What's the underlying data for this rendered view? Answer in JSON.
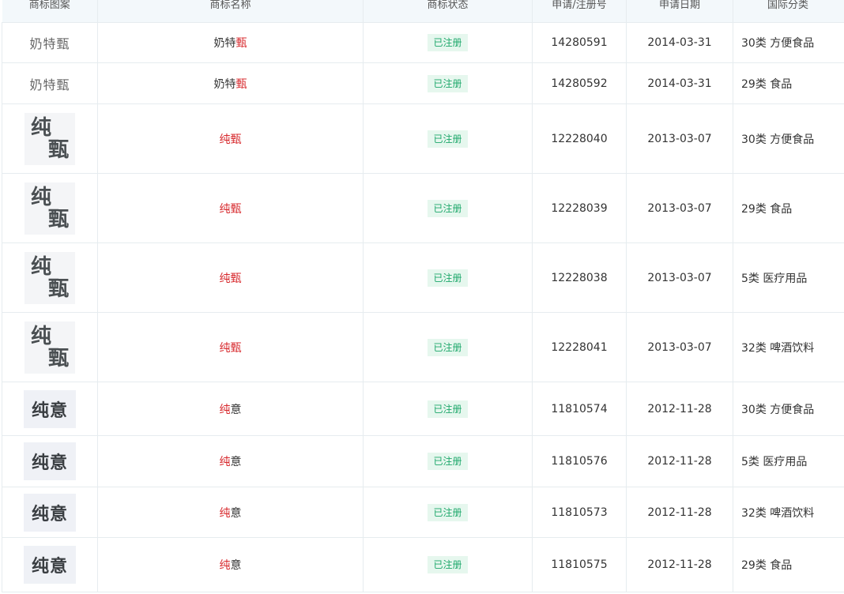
{
  "headers": [
    "商标图案",
    "商标名称",
    "商标状态",
    "申请/注册号",
    "申请日期",
    "国际分类"
  ],
  "rows": [
    {
      "logo_type": "text",
      "logo_text": "奶特甄",
      "name_plain": "奶特",
      "name_highlight": "甄",
      "name_tail": "",
      "status": "已注册",
      "reg_no": "14280591",
      "date": "2014-03-31",
      "category": "30类 方便食品"
    },
    {
      "logo_type": "text",
      "logo_text": "奶特甄",
      "name_plain": "奶特",
      "name_highlight": "甄",
      "name_tail": "",
      "status": "已注册",
      "reg_no": "14280592",
      "date": "2014-03-31",
      "category": "29类 食品"
    },
    {
      "logo_type": "vertical",
      "logo_top": "纯",
      "logo_bottom": "甄",
      "name_plain": "",
      "name_highlight": "纯甄",
      "name_tail": "",
      "status": "已注册",
      "reg_no": "12228040",
      "date": "2013-03-07",
      "category": "30类 方便食品"
    },
    {
      "logo_type": "vertical",
      "logo_top": "纯",
      "logo_bottom": "甄",
      "name_plain": "",
      "name_highlight": "纯甄",
      "name_tail": "",
      "status": "已注册",
      "reg_no": "12228039",
      "date": "2013-03-07",
      "category": "29类 食品"
    },
    {
      "logo_type": "vertical",
      "logo_top": "纯",
      "logo_bottom": "甄",
      "name_plain": "",
      "name_highlight": "纯甄",
      "name_tail": "",
      "status": "已注册",
      "reg_no": "12228038",
      "date": "2013-03-07",
      "category": "5类 医疗用品"
    },
    {
      "logo_type": "vertical",
      "logo_top": "纯",
      "logo_bottom": "甄",
      "name_plain": "",
      "name_highlight": "纯甄",
      "name_tail": "",
      "status": "已注册",
      "reg_no": "12228041",
      "date": "2013-03-07",
      "category": "32类 啤酒饮料"
    },
    {
      "logo_type": "horizontal",
      "logo_text": "纯意",
      "name_plain": "",
      "name_highlight": "纯",
      "name_tail": "意",
      "status": "已注册",
      "reg_no": "11810574",
      "date": "2012-11-28",
      "category": "30类 方便食品"
    },
    {
      "logo_type": "horizontal",
      "logo_text": "纯意",
      "name_plain": "",
      "name_highlight": "纯",
      "name_tail": "意",
      "status": "已注册",
      "reg_no": "11810576",
      "date": "2012-11-28",
      "category": "5类 医疗用品"
    },
    {
      "logo_type": "horizontal",
      "logo_text": "纯意",
      "name_plain": "",
      "name_highlight": "纯",
      "name_tail": "意",
      "status": "已注册",
      "reg_no": "11810573",
      "date": "2012-11-28",
      "category": "32类 啤酒饮料"
    },
    {
      "logo_type": "horizontal",
      "logo_text": "纯意",
      "name_plain": "",
      "name_highlight": "纯",
      "name_tail": "意",
      "status": "已注册",
      "reg_no": "11810575",
      "date": "2012-11-28",
      "category": "29类 食品"
    }
  ]
}
